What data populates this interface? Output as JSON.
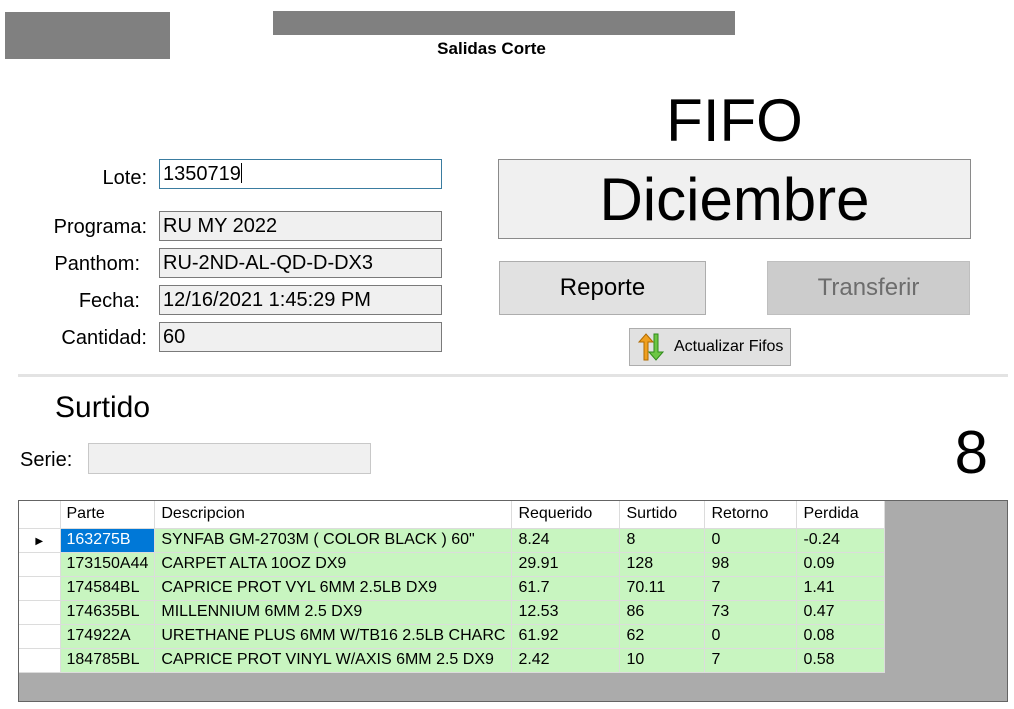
{
  "header": {
    "subtitle": "Salidas Corte"
  },
  "fifo": {
    "title": "FIFO",
    "month": "Diciembre"
  },
  "form": {
    "lote_label": "Lote:",
    "lote_value": "1350719",
    "programa_label": "Programa:",
    "programa_value": "RU MY 2022",
    "panthom_label": "Panthom:",
    "panthom_value": "RU-2ND-AL-QD-D-DX3",
    "fecha_label": "Fecha:",
    "fecha_value": "12/16/2021 1:45:29 PM",
    "cantidad_label": "Cantidad:",
    "cantidad_value": "60"
  },
  "buttons": {
    "reporte": "Reporte",
    "transferir": "Transferir",
    "actualizar": "Actualizar Fifos"
  },
  "surtido": {
    "title": "Surtido",
    "serie_label": "Serie:",
    "serie_value": "",
    "count": "8"
  },
  "grid": {
    "columns": [
      "Parte",
      "Descripcion",
      "Requerido",
      "Surtido",
      "Retorno",
      "Perdida"
    ],
    "rows": [
      [
        "163275B",
        "SYNFAB GM-2703M ( COLOR BLACK ) 60\"",
        "8.24",
        "8",
        "0",
        "-0.24"
      ],
      [
        "173150A44",
        "CARPET ALTA 10OZ DX9",
        "29.91",
        "128",
        "98",
        "0.09"
      ],
      [
        "174584BL",
        "CAPRICE PROT VYL 6MM 2.5LB DX9",
        "61.7",
        "70.11",
        "7",
        "1.41"
      ],
      [
        "174635BL",
        "MILLENNIUM 6MM 2.5 DX9",
        "12.53",
        "86",
        "73",
        "0.47"
      ],
      [
        "174922A",
        "URETHANE PLUS 6MM W/TB16 2.5LB CHARC",
        "61.92",
        "62",
        "0",
        "0.08"
      ],
      [
        "184785BL",
        "CAPRICE PROT VINYL W/AXIS 6MM 2.5 DX9",
        "2.42",
        "10",
        "7",
        "0.58"
      ]
    ]
  }
}
